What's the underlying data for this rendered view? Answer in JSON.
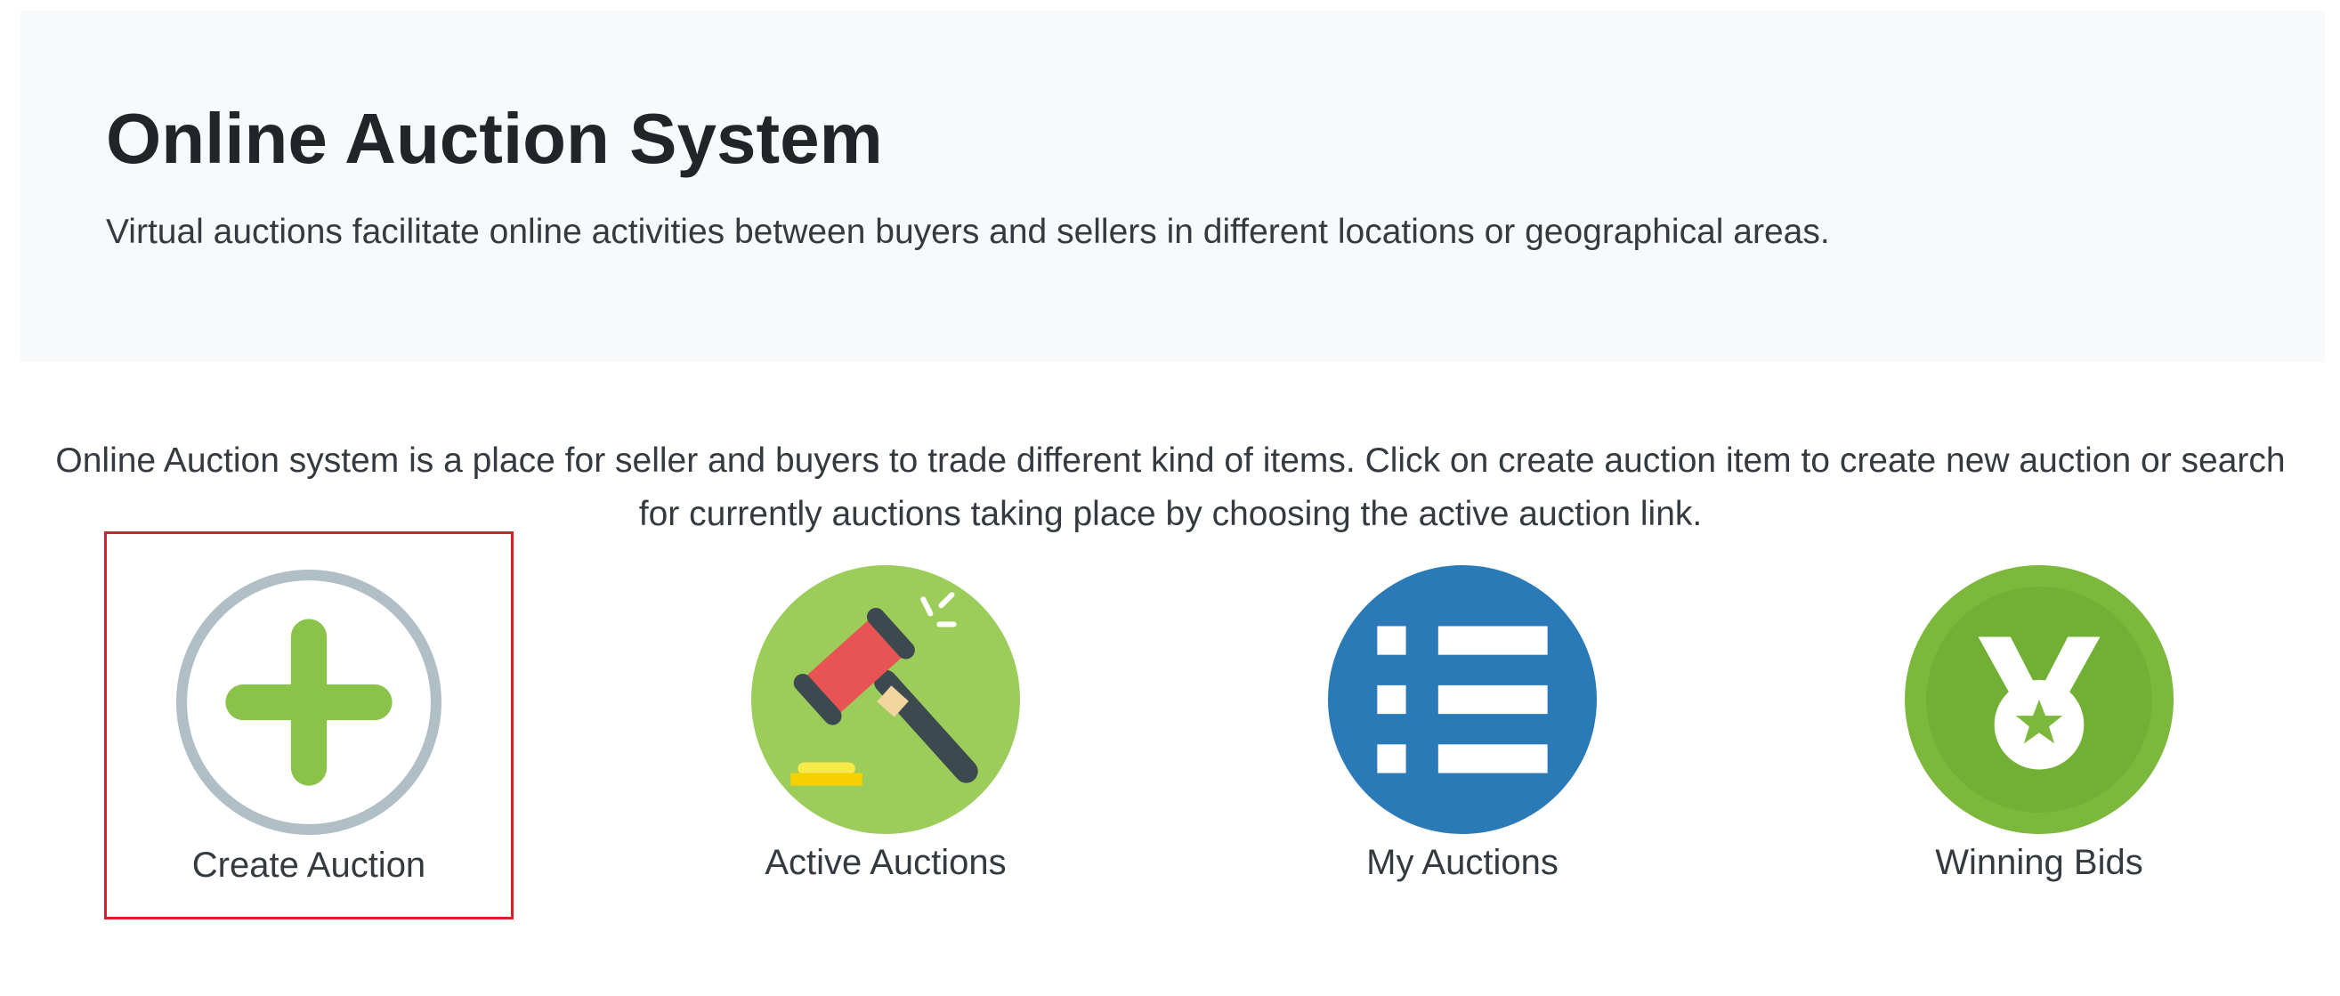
{
  "header": {
    "title": "Online Auction System",
    "subtitle": "Virtual auctions facilitate online activities between buyers and sellers in different locations or geographical areas."
  },
  "intro": "Online Auction system is a place for seller and buyers to trade different kind of items. Click on create auction item to create new auction or search for currently auctions taking place by choosing the active auction link.",
  "tiles": [
    {
      "label": "Create Auction",
      "icon": "plus-circle-icon",
      "selected": true
    },
    {
      "label": "Active Auctions",
      "icon": "gavel-icon",
      "selected": false
    },
    {
      "label": "My Auctions",
      "icon": "list-icon",
      "selected": false
    },
    {
      "label": "Winning Bids",
      "icon": "medal-icon",
      "selected": false
    }
  ],
  "colors": {
    "jumbotron_bg": "#f8f9fa",
    "selected_border": "#d61f26",
    "plus_green": "#8bc34a",
    "ring_gray": "#b0bec5",
    "gavel_bg": "#9ccc5a",
    "gavel_head": "#e85454",
    "list_blue": "#2a7ab8",
    "medal_green": "#7cb83b"
  }
}
